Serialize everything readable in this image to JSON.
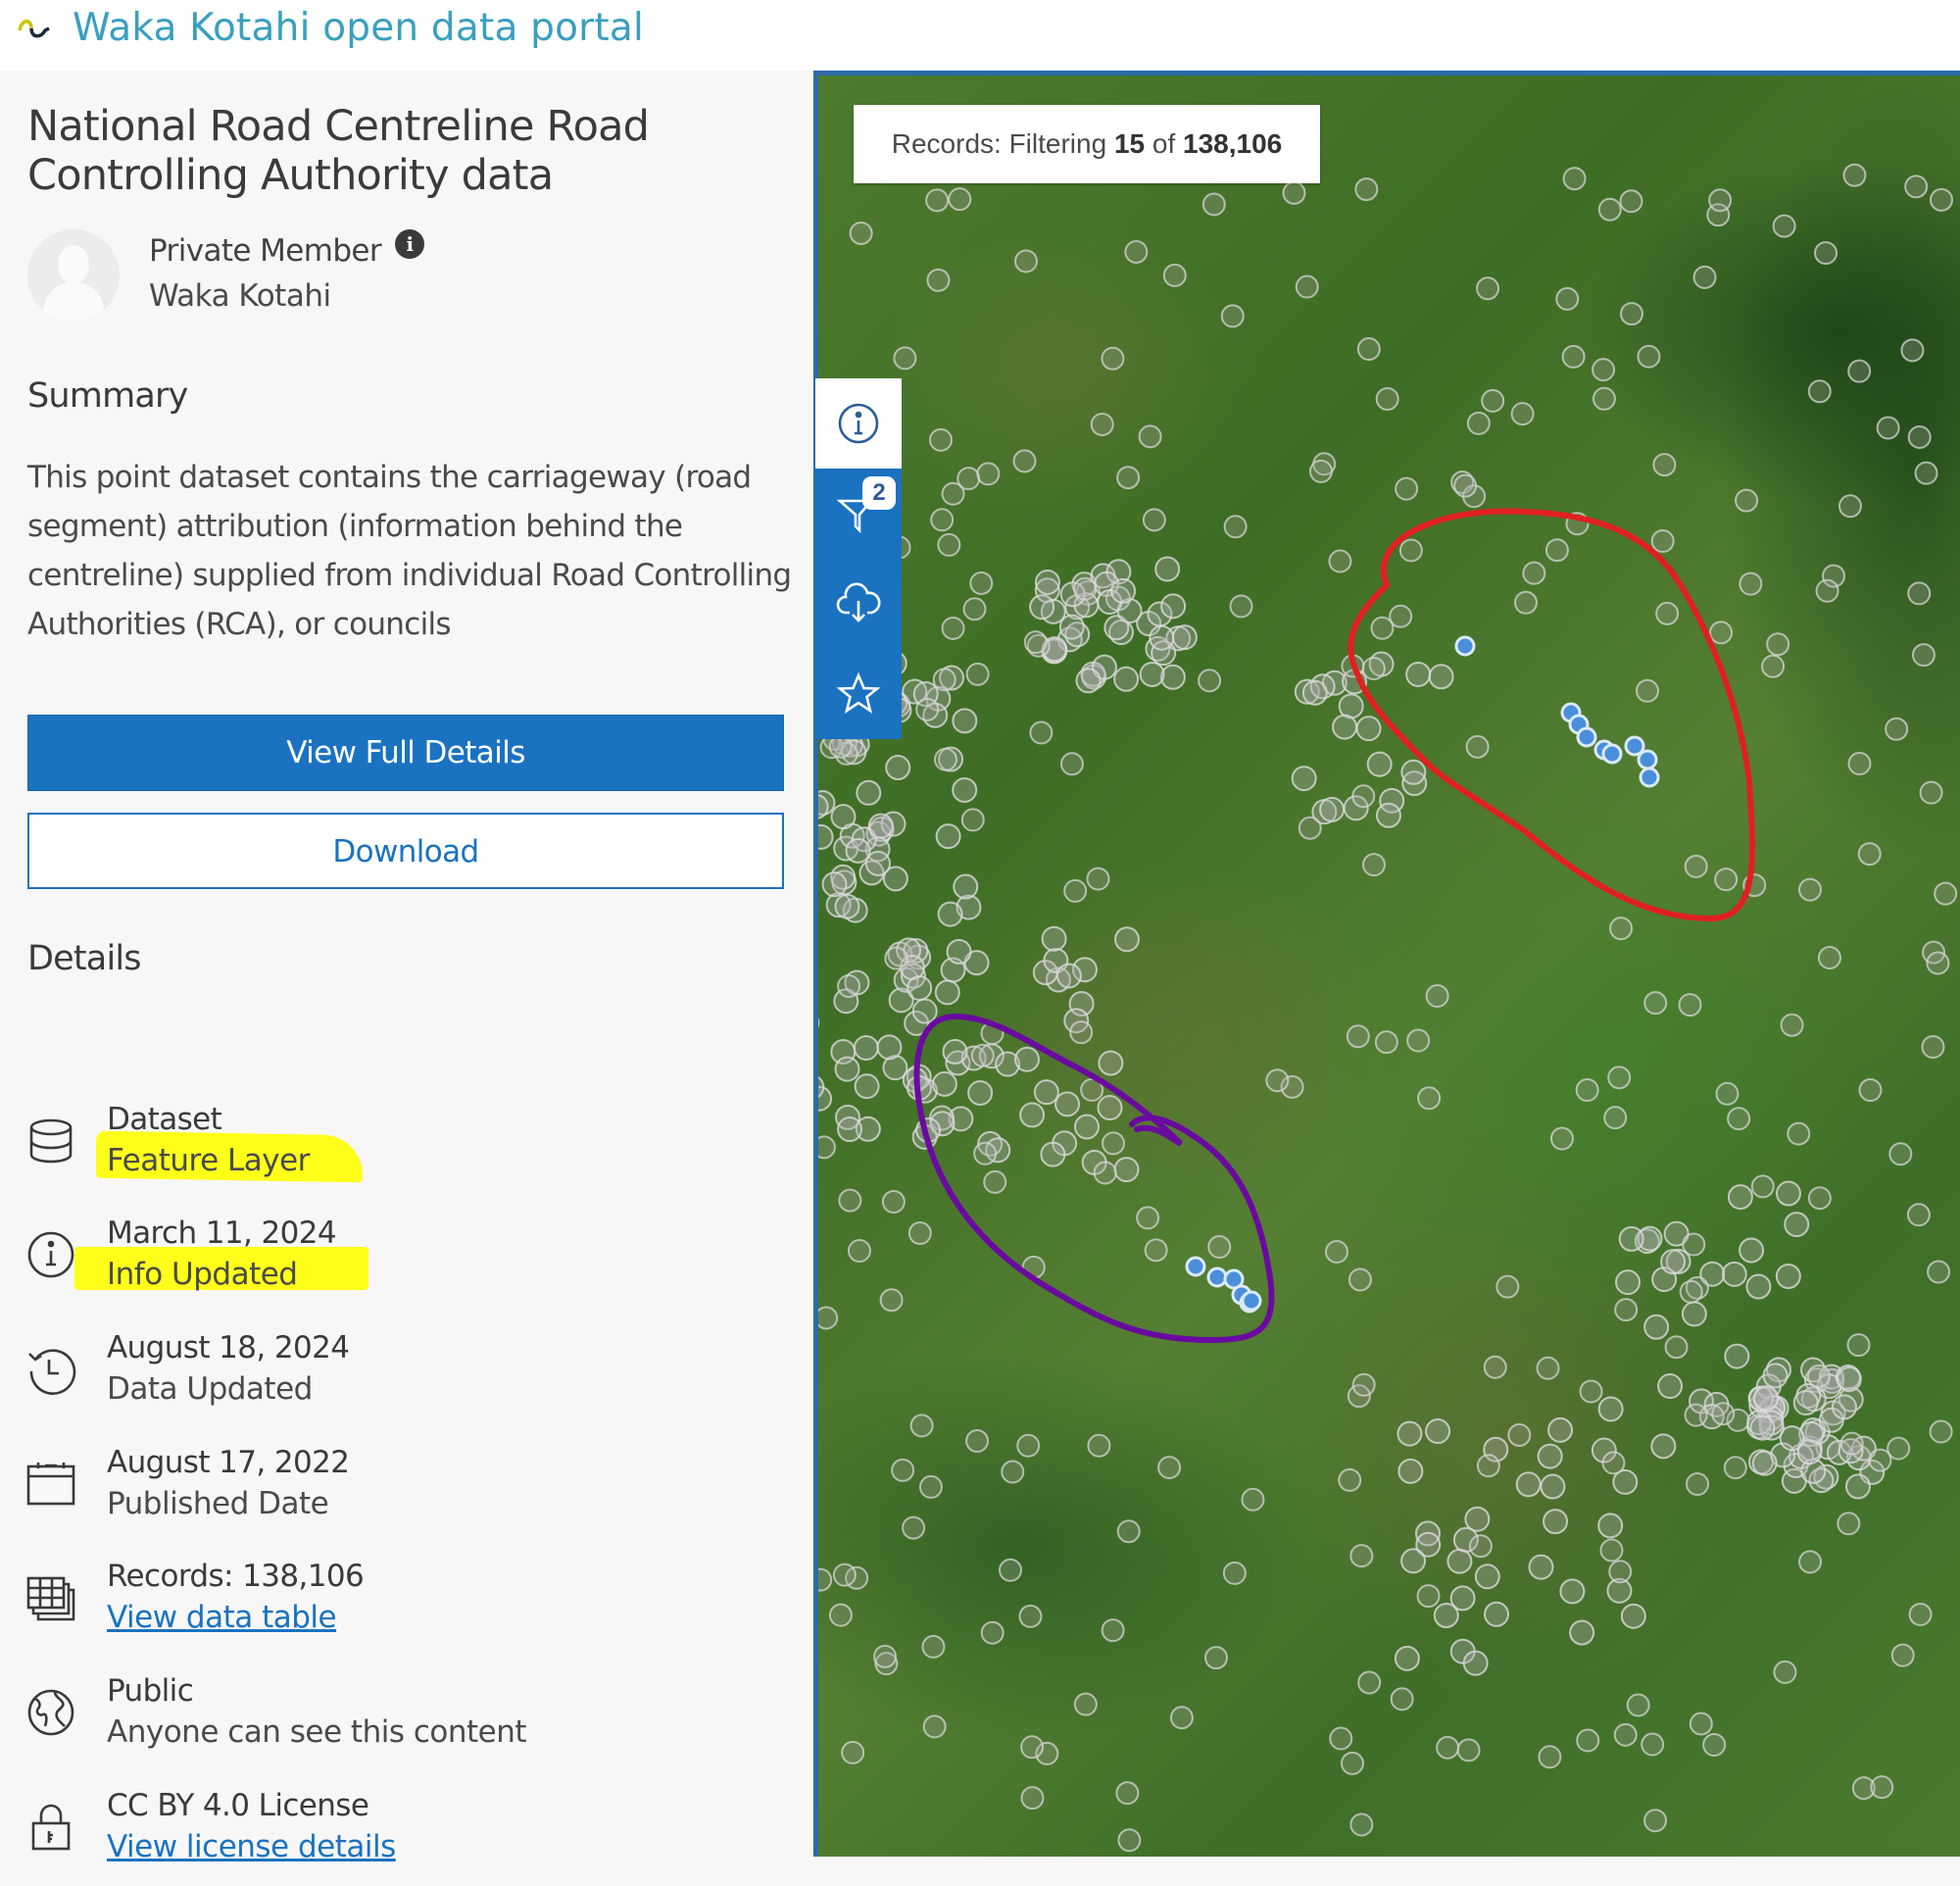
{
  "header": {
    "logo_icon": "waka-kotahi-logo-icon",
    "title": "Waka Kotahi open data portal"
  },
  "dataset": {
    "title": "National Road Centreline Road Controlling Authority data",
    "owner": {
      "name": "Private Member",
      "info_icon": "info-filled-icon",
      "organization": "Waka Kotahi"
    },
    "summary_heading": "Summary",
    "summary": "This point dataset contains the carriageway (road segment) attribution (information behind the centreline) supplied from individual Road Controlling Authorities (RCA), or councils",
    "buttons": {
      "view_full_details": "View Full Details",
      "download": "Download"
    },
    "details_heading": "Details",
    "details": [
      {
        "icon": "database-icon",
        "label": "Dataset",
        "sub": "Feature Layer",
        "link": false,
        "highlighted": false
      },
      {
        "icon": "info-icon",
        "label": "March 11, 2024",
        "sub": "Info Updated",
        "link": false,
        "highlighted": true
      },
      {
        "icon": "history-icon",
        "label": "August 18, 2024",
        "sub": "Data Updated",
        "link": false,
        "highlighted": true
      },
      {
        "icon": "calendar-icon",
        "label": "August 17, 2022",
        "sub": "Published Date",
        "link": false,
        "highlighted": false
      },
      {
        "icon": "table-icon",
        "label": "Records: 138,106",
        "sub": "View data table",
        "link": true,
        "highlighted": false
      },
      {
        "icon": "globe-icon",
        "label": "Public",
        "sub": "Anyone can see this content",
        "link": false,
        "highlighted": false
      },
      {
        "icon": "lock-icon",
        "label": "CC BY 4.0 License",
        "sub": "View license details",
        "link": true,
        "highlighted": false
      }
    ]
  },
  "map": {
    "records_prefix": "Records: Filtering ",
    "records_filtered": "15",
    "records_of": " of ",
    "records_total": "138,106",
    "tools": [
      {
        "icon": "info-icon",
        "active": true
      },
      {
        "icon": "filter-icon",
        "badge": "2"
      },
      {
        "icon": "cloud-download-icon"
      },
      {
        "icon": "star-icon"
      }
    ],
    "annotations": [
      {
        "name": "red-annotation",
        "color": "#e02020"
      },
      {
        "name": "purple-annotation",
        "color": "#6a0aa0"
      }
    ],
    "highlight_color": "#4a8fdc",
    "highlight_color_yellow": "#ffff1a"
  }
}
